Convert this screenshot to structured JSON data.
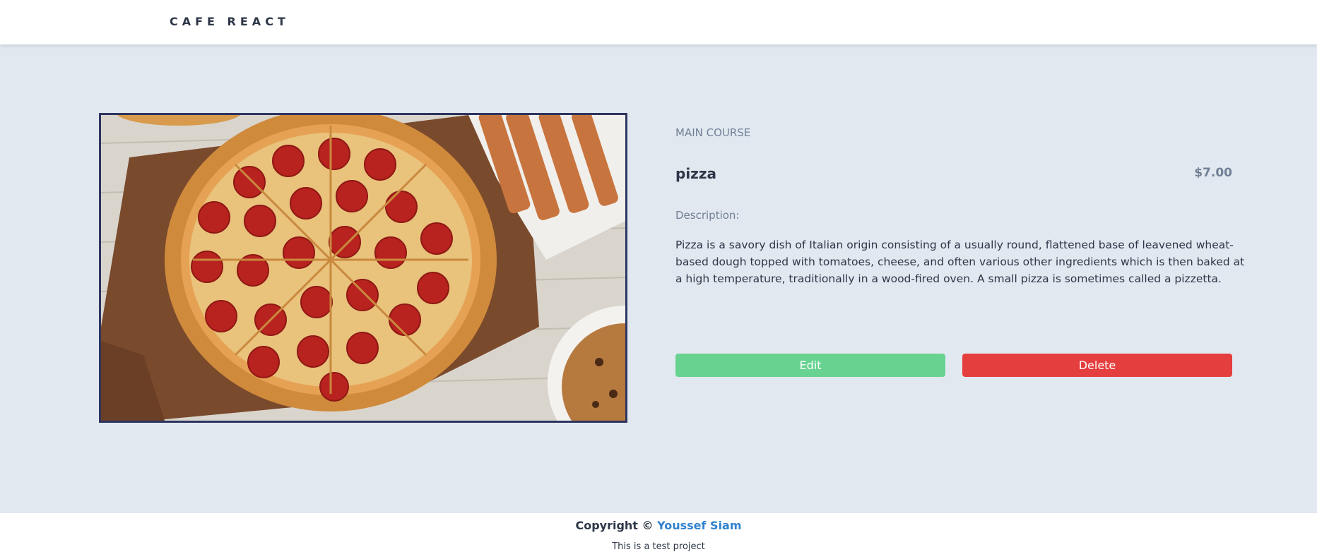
{
  "navbar": {
    "brand": "CAFE REACT"
  },
  "item": {
    "image_alt": "pepperoni pizza photo",
    "category": "MAIN COURSE",
    "name": "pizza",
    "price": "$7.00",
    "description_label": "Description:",
    "description": "Pizza is a savory dish of Italian origin consisting of a usually round, flattened base of leavened wheat-based dough topped with tomatoes, cheese, and often various other ingredients which is then baked at a high temperature, traditionally in a wood-fired oven. A small pizza is sometimes called a pizzetta."
  },
  "actions": {
    "edit_label": "Edit",
    "delete_label": "Delete"
  },
  "footer": {
    "copyright_prefix": "Copyright ©",
    "author": "Youssef Siam",
    "tagline": "This is a test project"
  },
  "colors": {
    "background": "#e2e8f0",
    "edit": "#68d391",
    "delete": "#e53e3e",
    "link": "#3182ce",
    "frame": "#2d3561"
  }
}
